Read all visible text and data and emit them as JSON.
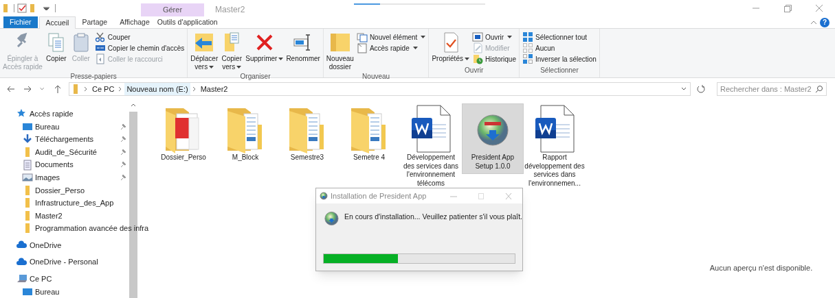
{
  "title_bar": {
    "context_group": "Gérer",
    "title": "Master2",
    "loading_bar": {
      "level": 0.2
    },
    "help": "?"
  },
  "tabs": [
    {
      "label": "Fichier",
      "kind": "file",
      "selected": false
    },
    {
      "label": "Accueil",
      "kind": "normal",
      "selected": true
    },
    {
      "label": "Partage",
      "kind": "normal",
      "selected": false
    },
    {
      "label": "Affichage",
      "kind": "normal",
      "selected": false
    },
    {
      "label": "Outils d'application",
      "kind": "context",
      "selected": false
    }
  ],
  "ribbon": {
    "groups": [
      {
        "label": "Presse-papiers",
        "columns": [
          [
            {
              "label": "Épingler à\nAccès rapide",
              "kind": "large",
              "disabled": true
            }
          ],
          [
            {
              "label": "Copier",
              "kind": "large",
              "disabled": false
            }
          ],
          [
            {
              "label": "Coller",
              "kind": "large",
              "disabled": true
            }
          ],
          [
            {
              "label": "Couper",
              "kind": "small",
              "disabled": false
            },
            {
              "label": "Copier le chemin d'accès",
              "kind": "small",
              "disabled": false
            },
            {
              "label": "Coller le raccourci",
              "kind": "small",
              "disabled": true
            }
          ]
        ]
      },
      {
        "label": "Organiser",
        "columns": [
          [
            {
              "label": "Déplacer\nvers",
              "kind": "large",
              "disabled": false,
              "dropdown": true
            }
          ],
          [
            {
              "label": "Copier\nvers",
              "kind": "large",
              "disabled": false,
              "dropdown": true
            }
          ],
          [
            {
              "label": "Supprimer",
              "kind": "large",
              "disabled": false,
              "dropdown": true
            }
          ],
          [
            {
              "label": "Renommer",
              "kind": "large",
              "disabled": false
            }
          ]
        ]
      },
      {
        "label": "Nouveau",
        "columns": [
          [
            {
              "label": "Nouveau\ndossier",
              "kind": "large",
              "disabled": false
            }
          ],
          [
            {
              "label": "Nouvel élément",
              "kind": "small",
              "disabled": false,
              "dropdown": true
            },
            {
              "label": "Accès rapide",
              "kind": "small",
              "disabled": false,
              "dropdown": true
            }
          ]
        ]
      },
      {
        "label": "Ouvrir",
        "columns": [
          [
            {
              "label": "Propriétés",
              "kind": "large",
              "disabled": false,
              "dropdown": true
            }
          ],
          [
            {
              "label": "Ouvrir",
              "kind": "small",
              "disabled": false,
              "dropdown": true
            },
            {
              "label": "Modifier",
              "kind": "small",
              "disabled": true
            },
            {
              "label": "Historique",
              "kind": "small",
              "disabled": false
            }
          ]
        ]
      },
      {
        "label": "Sélectionner",
        "columns": [
          [
            {
              "label": "Sélectionner tout",
              "kind": "small",
              "disabled": false
            },
            {
              "label": "Aucun",
              "kind": "small",
              "disabled": false
            },
            {
              "label": "Inverser la sélection",
              "kind": "small",
              "disabled": false
            }
          ]
        ]
      }
    ]
  },
  "address_bar": {
    "crumbs": [
      {
        "label": "Ce PC",
        "highlighted": false
      },
      {
        "label": "Nouveau nom (E:)",
        "highlighted": true
      },
      {
        "label": "Master2",
        "highlighted": false
      }
    ],
    "search_placeholder": "Rechercher dans : Master2"
  },
  "sidebar": {
    "items": [
      {
        "label": "Accès rapide",
        "kind": "star",
        "children": [
          {
            "label": "Bureau",
            "kind": "desktop",
            "pinned": true
          },
          {
            "label": "Téléchargements",
            "kind": "download",
            "pinned": true
          },
          {
            "label": "Audit_de_Sécurité",
            "kind": "folder",
            "pinned": true
          },
          {
            "label": "Documents",
            "kind": "document",
            "pinned": true
          },
          {
            "label": "Images",
            "kind": "images",
            "pinned": true
          },
          {
            "label": "Dossier_Perso",
            "kind": "folder",
            "pinned": false
          },
          {
            "label": "Infrastructure_des_App",
            "kind": "folder",
            "pinned": false
          },
          {
            "label": "Master2",
            "kind": "folder",
            "pinned": false
          },
          {
            "label": "Programmation avancée des infra",
            "kind": "folder",
            "pinned": false
          }
        ]
      },
      {
        "label": "OneDrive",
        "kind": "cloud"
      },
      {
        "label": "OneDrive - Personal",
        "kind": "cloud"
      },
      {
        "label": "Ce PC",
        "kind": "pc",
        "children": [
          {
            "label": "Bureau",
            "kind": "desktop",
            "pinned": false
          }
        ]
      }
    ]
  },
  "files": [
    {
      "name": "Dossier_Perso",
      "kind": "pdffolder",
      "selected": false
    },
    {
      "name": "M_Block",
      "kind": "folder",
      "selected": false
    },
    {
      "name": "Semestre3",
      "kind": "folder",
      "selected": false
    },
    {
      "name": "Semetre 4",
      "kind": "folder",
      "selected": false
    },
    {
      "name": "Développement des services dans l'environnement télécoms",
      "kind": "word",
      "selected": false
    },
    {
      "name": "President App Setup 1.0.0",
      "kind": "setup",
      "selected": true
    },
    {
      "name": "Rapport développement des services dans l'environnemen...",
      "kind": "word",
      "selected": false
    }
  ],
  "preview": {
    "message": "Aucun aperçu n'est disponible."
  },
  "dialog": {
    "title": "Installation de President App",
    "message": "En cours d'installation... Veuillez patienter s'il vous plaît.",
    "progress": {
      "level": 0.39
    }
  }
}
